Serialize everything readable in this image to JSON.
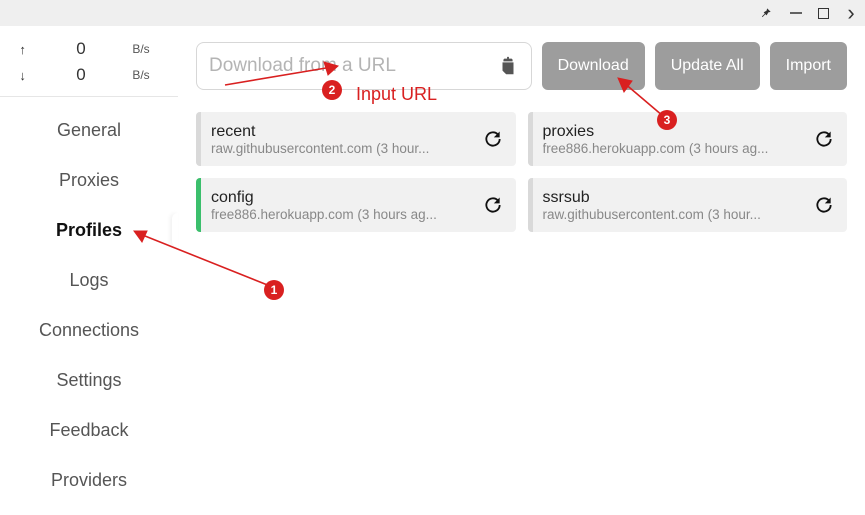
{
  "window": {
    "pin": "📌",
    "min": "—",
    "max": "▢",
    "close": "›"
  },
  "traffic": {
    "up": {
      "arrow": "↑",
      "value": "0",
      "unit": "B/s"
    },
    "down": {
      "arrow": "↓",
      "value": "0",
      "unit": "B/s"
    }
  },
  "nav": {
    "items": [
      {
        "label": "General"
      },
      {
        "label": "Proxies"
      },
      {
        "label": "Profiles",
        "active": true
      },
      {
        "label": "Logs"
      },
      {
        "label": "Connections"
      },
      {
        "label": "Settings"
      },
      {
        "label": "Feedback"
      },
      {
        "label": "Providers"
      }
    ]
  },
  "urlbar": {
    "placeholder": "Download from a URL"
  },
  "buttons": {
    "download": "Download",
    "update": "Update All",
    "import": "Import"
  },
  "profiles": [
    {
      "title": "recent",
      "sub": "raw.githubusercontent.com (3 hour...",
      "active": false
    },
    {
      "title": "proxies",
      "sub": "free886.herokuapp.com (3 hours ag...",
      "active": false
    },
    {
      "title": "config",
      "sub": "free886.herokuapp.com (3 hours ag...",
      "active": true
    },
    {
      "title": "ssrsub",
      "sub": "raw.githubusercontent.com (3 hour...",
      "active": false
    }
  ],
  "annotations": {
    "badge1": "1",
    "badge2": "2",
    "badge3": "3",
    "label2": "Input URL"
  }
}
